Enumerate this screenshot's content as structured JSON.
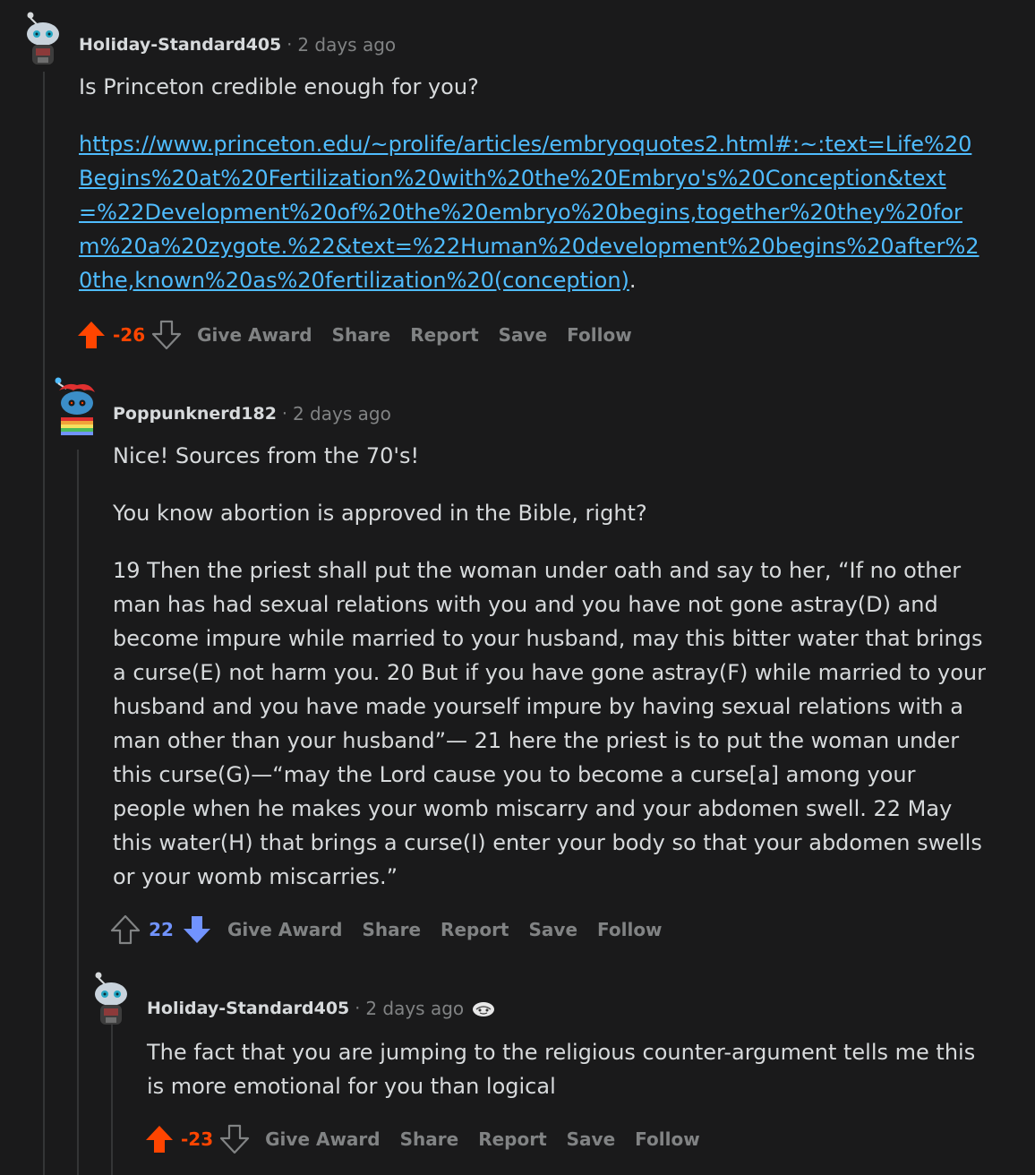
{
  "comments": [
    {
      "author": "Holiday-Standard405",
      "separator": "·",
      "time": "2 days ago",
      "avatar_icon": "snoo-avatar-icon",
      "text_intro": "Is Princeton credible enough for you?",
      "link": "https://www.princeton.edu/~prolife/articles/embryoquotes2.html#:~:text=Life%20Begins%20at%20Fertilization%20with%20the%20Embryo's%20Conception&text=%22Development%20of%20the%20embryo%20begins,together%20they%20form%20a%20zygote.%22&text=%22Human%20development%20begins%20after%20the,known%20as%20fertilization%20(conception)",
      "link_suffix": ".",
      "score": "-26",
      "vote_state": "up",
      "actions": [
        "Give Award",
        "Share",
        "Report",
        "Save",
        "Follow"
      ]
    },
    {
      "author": "Poppunknerd182",
      "separator": "·",
      "time": "2 days ago",
      "avatar_icon": "snoo-avatar-red-hair-icon",
      "paragraphs": [
        "Nice! Sources from the 70's!",
        "You know abortion is approved in the Bible, right?",
        "19 Then the priest shall put the woman under oath and say to her, “If no other man has had sexual relations with you and you have not gone astray(D) and become impure while married to your husband, may this bitter water that brings a curse(E) not harm you. 20 But if you have gone astray(F) while married to your husband and you have made yourself impure by having sexual relations with a man other than your husband”— 21 here the priest is to put the woman under this curse(G)—“may the Lord cause you to become a curse[a] among your people when he makes your womb miscarry and your abdomen swell. 22 May this water(H) that brings a curse(I) enter your body so that your abdomen swells or your womb miscarries.”"
      ],
      "score": "22",
      "vote_state": "down",
      "actions": [
        "Give Award",
        "Share",
        "Report",
        "Save",
        "Follow"
      ]
    },
    {
      "author": "Holiday-Standard405",
      "separator": "·",
      "time": "2 days ago",
      "avatar_icon": "snoo-avatar-icon",
      "flair_icon": "flair-emoji-icon",
      "paragraphs": [
        "The fact that you are jumping to the religious counter-argument tells me this is more emotional for you than logical"
      ],
      "score": "-23",
      "vote_state": "up",
      "actions": [
        "Give Award",
        "Share",
        "Report",
        "Save",
        "Follow"
      ]
    }
  ],
  "colors": {
    "background": "#1a1a1b",
    "text": "#d7dadc",
    "muted": "#818384",
    "upvote": "#ff4500",
    "downvote": "#7193ff",
    "link": "#4fbcff",
    "thread_line": "#343536"
  }
}
